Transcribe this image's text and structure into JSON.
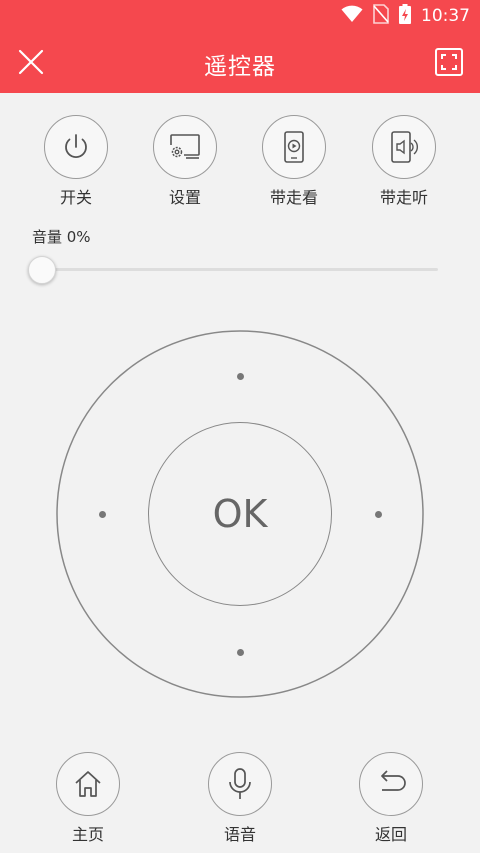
{
  "status_bar": {
    "time": "10:37"
  },
  "header": {
    "title": "遥控器"
  },
  "functions": [
    {
      "label": "开关",
      "icon": "power-icon"
    },
    {
      "label": "设置",
      "icon": "settings-screen-icon"
    },
    {
      "label": "带走看",
      "icon": "phone-play-icon"
    },
    {
      "label": "带走听",
      "icon": "phone-speaker-icon"
    }
  ],
  "volume": {
    "label": "音量 0%",
    "level": 0
  },
  "dpad": {
    "ok_label": "OK"
  },
  "bottom": [
    {
      "label": "主页",
      "icon": "home-icon"
    },
    {
      "label": "语音",
      "icon": "microphone-icon"
    },
    {
      "label": "返回",
      "icon": "back-arrow-icon"
    }
  ],
  "colors": {
    "header_bg": "#f5484e",
    "background": "#f2f2f2"
  }
}
